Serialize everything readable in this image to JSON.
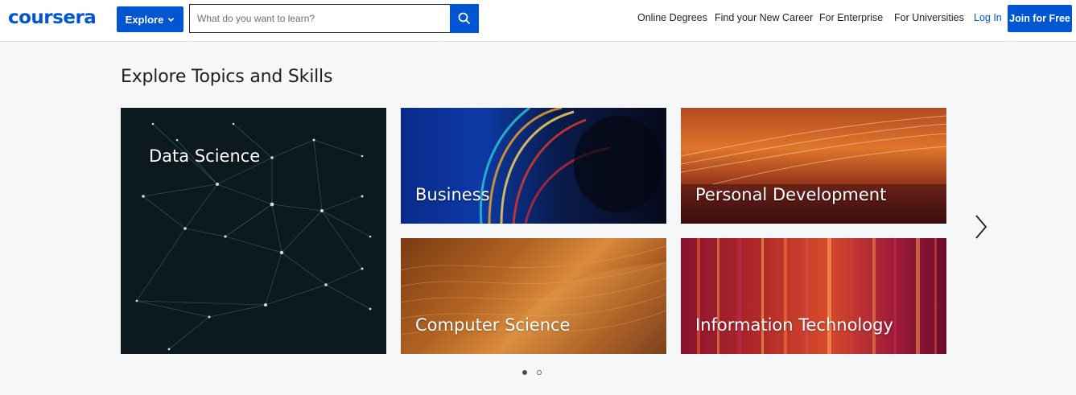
{
  "header": {
    "logo": "coursera",
    "explore_label": "Explore",
    "search_placeholder": "What do you want to learn?",
    "nav": [
      "Online Degrees",
      "Find your New Career",
      "For Enterprise",
      "For Universities"
    ],
    "login_label": "Log In",
    "join_label": "Join for Free"
  },
  "section": {
    "title": "Explore Topics and Skills",
    "topics": [
      "Data Science",
      "Business",
      "Personal Development",
      "Computer Science",
      "Information Technology"
    ],
    "carousel_pages": 2,
    "active_page": 1
  },
  "colors": {
    "brand": "#0056d2"
  }
}
